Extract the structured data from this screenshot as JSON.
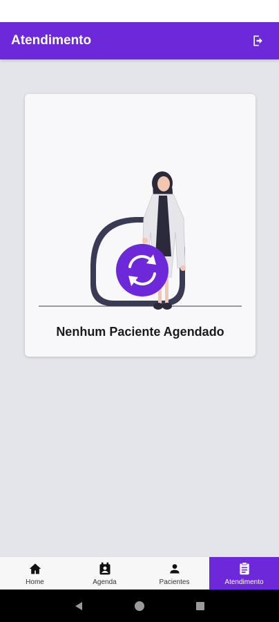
{
  "app_bar": {
    "title": "Atendimento",
    "logout_icon": "logout-icon"
  },
  "empty_state": {
    "message": "Nenhum Paciente Agendado",
    "refresh_icon": "refresh-icon"
  },
  "bottom_nav": {
    "items": [
      {
        "label": "Home",
        "icon": "home-icon",
        "active": false
      },
      {
        "label": "Agenda",
        "icon": "calendar-contact-icon",
        "active": false
      },
      {
        "label": "Pacientes",
        "icon": "person-icon",
        "active": false
      },
      {
        "label": "Atendimento",
        "icon": "clipboard-icon",
        "active": true
      }
    ]
  },
  "colors": {
    "primary": "#6d28d9",
    "background": "#e4e5ea",
    "card": "#f8f8fa"
  }
}
